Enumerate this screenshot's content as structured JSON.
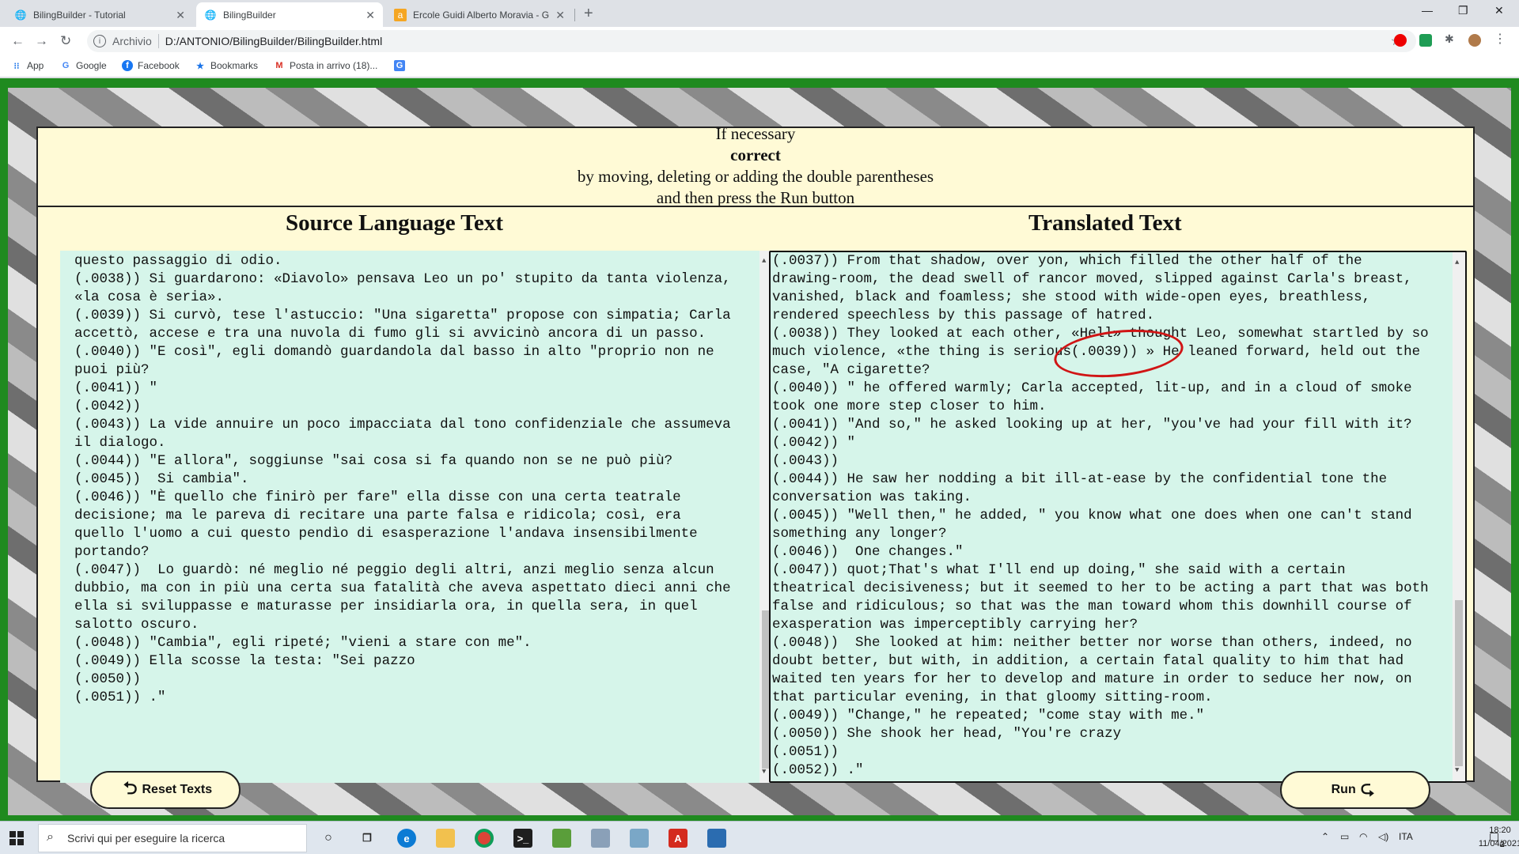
{
  "browser": {
    "tabs": [
      {
        "title": "BilingBuilder - Tutorial",
        "active": false
      },
      {
        "title": "BilingBuilder",
        "active": true
      },
      {
        "title": "Ercole Guidi Alberto Moravia - G",
        "active": false
      }
    ],
    "address": {
      "protocol": "Archivio",
      "path": "D:/ANTONIO/BilingBuilder/BilingBuilder.html"
    },
    "bookmarks": [
      "App",
      "Google",
      "Facebook",
      "Bookmarks",
      "Posta in arrivo (18)..."
    ]
  },
  "instructions": {
    "line1": "If necessary",
    "line2": "correct",
    "line3": "by moving, deleting or adding the double parentheses",
    "line4": "and then press the Run button"
  },
  "source": {
    "title": "Source Language Text",
    "lines": [
      "questo passaggio di odio.",
      "(.0038)) Si guardarono: «Diavolo» pensava Leo un po' stupito da tanta violenza,",
      "«la cosa è seria».",
      "(.0039)) Si curvò, tese l'astuccio: \"Una sigaretta\" propose con simpatia; Carla",
      "accettò, accese e tra una nuvola di fumo gli si avvicinò ancora di un passo.",
      "(.0040)) \"E così\", egli domandò guardandola dal basso in alto \"proprio non ne",
      "puoi più?",
      "(.0041)) \"",
      "(.0042))",
      "(.0043)) La vide annuire un poco impacciata dal tono confidenziale che assumeva",
      "il dialogo.",
      "(.0044)) \"E allora\", soggiunse \"sai cosa si fa quando non se ne può più?",
      "(.0045))  Si cambia\".",
      "(.0046)) \"È quello che finirò per fare\" ella disse con una certa teatrale",
      "decisione; ma le pareva di recitare una parte falsa e ridicola; così, era",
      "quello l'uomo a cui questo pendìo di esasperazione l'andava insensibilmente",
      "portando?",
      "(.0047))  Lo guardò: né meglio né peggio degli altri, anzi meglio senza alcun",
      "dubbio, ma con in più una certa sua fatalità che aveva aspettato dieci anni che",
      "ella si sviluppasse e maturasse per insidiarla ora, in quella sera, in quel",
      "salotto oscuro.",
      "(.0048)) \"Cambia\", egli ripeté; \"vieni a stare con me\".",
      "(.0049)) Ella scosse la testa: \"Sei pazzo",
      "(.0050))",
      "(.0051)) .\""
    ]
  },
  "target": {
    "title": "Translated Text",
    "lines": [
      "(.0037)) From that shadow, over yon, which filled the other half of the",
      "drawing-room, the dead swell of rancor moved, slipped against Carla's breast,",
      "vanished, black and foamless; she stood with wide-open eyes, breathless,",
      "rendered speechless by this passage of hatred.",
      "(.0038)) They looked at each other, «Hell» thought Leo, somewhat startled by so",
      "much violence, «the thing is serious(.0039)) » He leaned forward, held out the",
      "case, \"A cigarette?",
      "(.0040)) \" he offered warmly; Carla accepted, lit-up, and in a cloud of smoke",
      "took one more step closer to him.",
      "(.0041)) \"And so,\" he asked looking up at her, \"you've had your fill with it?",
      "(.0042)) \"",
      "(.0043))",
      "(.0044)) He saw her nodding a bit ill-at-ease by the confidential tone the",
      "conversation was taking.",
      "(.0045)) \"Well then,\" he added, \" you know what one does when one can't stand",
      "something any longer?",
      "(.0046))  One changes.\"",
      "(.0047)) quot;That's what I'll end up doing,\" she said with a certain",
      "theatrical decisiveness; but it seemed to her to be acting a part that was both",
      "false and ridiculous; so that was the man toward whom this downhill course of",
      "exasperation was imperceptibly carrying her?",
      "(.0048))  She looked at him: neither better nor worse than others, indeed, no",
      "doubt better, but with, in addition, a certain fatal quality to him that had",
      "waited ten years for her to develop and mature in order to seduce her now, on",
      "that particular evening, in that gloomy sitting-room.",
      "(.0049)) \"Change,\" he repeated; \"come stay with me.\"",
      "(.0050)) She shook her head, \"You're crazy",
      "(.0051))",
      "(.0052)) .\""
    ]
  },
  "buttons": {
    "reset": "Reset Texts",
    "run": "Run"
  },
  "taskbar": {
    "search_placeholder": "Scrivi qui per eseguire la ricerca",
    "lang": "ITA",
    "time": "18:20",
    "date": "11/04/2021",
    "notifications": "2"
  }
}
